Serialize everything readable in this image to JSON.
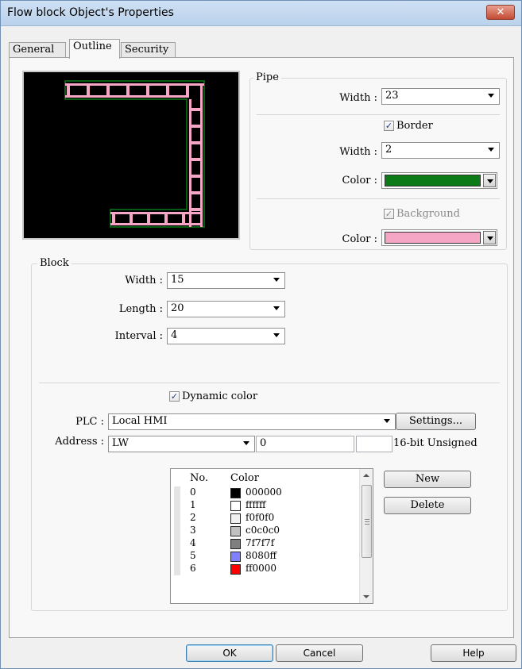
{
  "window": {
    "title": "Flow block Object's Properties",
    "close_glyph": "✕"
  },
  "tabs": [
    {
      "label": "General"
    },
    {
      "label": "Outline",
      "active": true
    },
    {
      "label": "Security"
    }
  ],
  "preview": {
    "pipe_fill": "#f4a6c4",
    "border_color": "#0b7a17"
  },
  "pipe": {
    "group_label": "Pipe",
    "width_label": "Width :",
    "width_value": "23",
    "border_label": "Border",
    "border_checked": true,
    "border_width_label": "Width :",
    "border_width_value": "2",
    "border_color_label": "Color :",
    "border_color": "#0b7a17",
    "background_label": "Background",
    "background_checked": true,
    "background_color_label": "Color :",
    "background_color": "#f4a6c4"
  },
  "block": {
    "group_label": "Block",
    "width_label": "Width :",
    "width_value": "15",
    "length_label": "Length :",
    "length_value": "20",
    "interval_label": "Interval :",
    "interval_value": "4",
    "dynamic_color_label": "Dynamic color",
    "dynamic_color_checked": true,
    "plc_label": "PLC :",
    "plc_value": "Local HMI",
    "settings_button": "Settings...",
    "address_label": "Address :",
    "address_device": "LW",
    "address_value": "0",
    "address_extra": "",
    "data_format": "16-bit Unsigned",
    "list_headers": {
      "no": "No.",
      "color": "Color"
    },
    "colors": [
      {
        "no": "0",
        "hex": "000000",
        "swatch": "#000000"
      },
      {
        "no": "1",
        "hex": "ffffff",
        "swatch": "#ffffff"
      },
      {
        "no": "2",
        "hex": "f0f0f0",
        "swatch": "#f0f0f0"
      },
      {
        "no": "3",
        "hex": "c0c0c0",
        "swatch": "#c0c0c0"
      },
      {
        "no": "4",
        "hex": "7f7f7f",
        "swatch": "#7f7f7f"
      },
      {
        "no": "5",
        "hex": "8080ff",
        "swatch": "#8080ff"
      },
      {
        "no": "6",
        "hex": "ff0000",
        "swatch": "#ff0000"
      }
    ],
    "new_button": "New",
    "delete_button": "Delete"
  },
  "footer": {
    "ok": "OK",
    "cancel": "Cancel",
    "help": "Help"
  }
}
